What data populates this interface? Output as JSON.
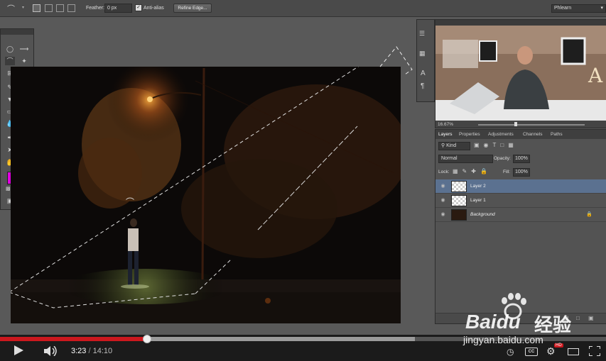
{
  "options_bar": {
    "feather_label": "Feather:",
    "feather_value": "0 px",
    "antialias_label": "Anti-alias",
    "refine_edge_label": "Refine Edge...",
    "workspace_value": "Phlearn"
  },
  "video_panel": {
    "zoom": "16.67%"
  },
  "layers_panel": {
    "tabs": [
      "Layers",
      "Properties",
      "Adjustments",
      "Channels",
      "Paths"
    ],
    "filter_kind": "Kind",
    "blend_mode": "Normal",
    "opacity_label": "Opacity:",
    "opacity_value": "100%",
    "lock_label": "Lock:",
    "fill_label": "Fill:",
    "fill_value": "100%",
    "layers": [
      {
        "name": "Layer 2",
        "selected": true
      },
      {
        "name": "Layer 1",
        "selected": false
      },
      {
        "name": "Background",
        "selected": false
      }
    ]
  },
  "player": {
    "current_time": "3:23",
    "separator": "/",
    "duration": "14:10",
    "played_fraction": 0.243,
    "buffered_fraction": 0.685,
    "hd_badge": "HD"
  },
  "watermark": {
    "brand": "Baidu",
    "cn": "经验",
    "url": "jingyan.baidu.com"
  },
  "colors": {
    "foreground": "#e000e0",
    "background": "#ffffff",
    "progress_red": "#cc181e",
    "selected_layer": "#5b7190"
  },
  "icons": [
    "lasso-icon",
    "marquee-icon",
    "move-icon",
    "magic-wand-icon",
    "crop-icon",
    "eyedropper-icon",
    "brush-icon",
    "stamp-icon",
    "eraser-icon",
    "gradient-icon",
    "pen-icon",
    "type-icon",
    "hand-icon",
    "zoom-icon",
    "eye-icon",
    "lock-icon",
    "play-icon",
    "volume-icon",
    "settings-icon",
    "fullscreen-icon",
    "cc-icon",
    "theater-icon",
    "watch-later-icon"
  ]
}
